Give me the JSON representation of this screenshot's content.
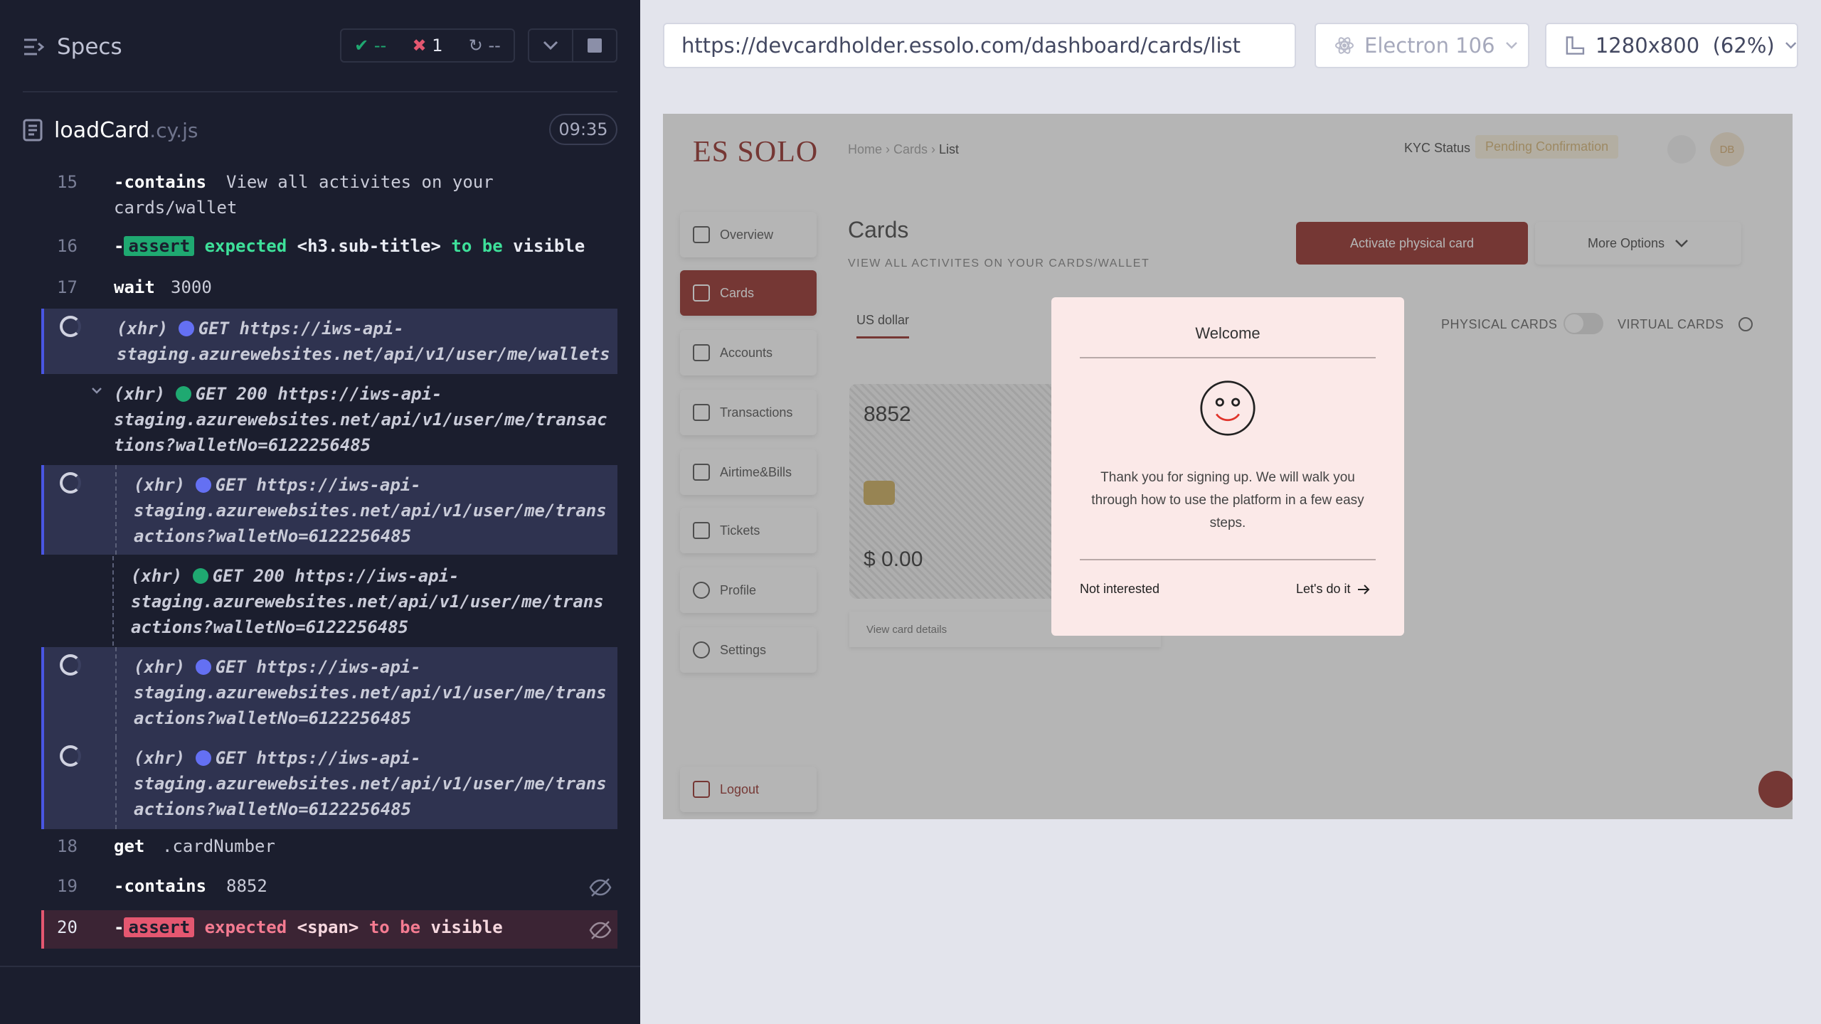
{
  "runner": {
    "title": "Specs",
    "stats": {
      "passed": "--",
      "failed": "1",
      "pending": "--"
    },
    "file": {
      "name": "loadCard",
      "ext": ".cy.js",
      "duration": "09:35"
    }
  },
  "log": {
    "l15": {
      "num": "15",
      "cmd": "-contains",
      "msg_1": "View all activites on your",
      "msg_2": "cards/wallet"
    },
    "l16": {
      "num": "16",
      "tag": "assert",
      "p1": "expected",
      "p2": "<h3.sub-title>",
      "p3": "to be",
      "p4": "visible"
    },
    "l17": {
      "num": "17",
      "cmd": "wait",
      "msg": "3000"
    },
    "x1": {
      "prefix": "(xhr)",
      "verb": "GET",
      "l1": "https://iws-api-",
      "l2": "staging.azurewebsites.net/api/v1/user/me/wallets"
    },
    "x2": {
      "prefix": "(xhr)",
      "verb": "GET 200",
      "l1": "https://iws-api-",
      "l2": "staging.azurewebsites.net/api/v1/user/me/transac",
      "l3": "tions?walletNo=6122256485"
    },
    "x3": {
      "prefix": "(xhr)",
      "verb": "GET",
      "l1": "https://iws-api-",
      "l2": "staging.azurewebsites.net/api/v1/user/me/trans",
      "l3": "actions?walletNo=6122256485"
    },
    "x4": {
      "prefix": "(xhr)",
      "verb": "GET 200",
      "l1": "https://iws-api-",
      "l2": "staging.azurewebsites.net/api/v1/user/me/trans",
      "l3": "actions?walletNo=6122256485"
    },
    "x5": {
      "prefix": "(xhr)",
      "verb": "GET",
      "l1": "https://iws-api-",
      "l2": "staging.azurewebsites.net/api/v1/user/me/trans",
      "l3": "actions?walletNo=6122256485"
    },
    "x6": {
      "prefix": "(xhr)",
      "verb": "GET",
      "l1": "https://iws-api-",
      "l2": "staging.azurewebsites.net/api/v1/user/me/trans",
      "l3": "actions?walletNo=6122256485"
    },
    "l18": {
      "num": "18",
      "cmd": "get",
      "msg": ".cardNumber"
    },
    "l19": {
      "num": "19",
      "cmd": "-contains",
      "msg": "8852"
    },
    "l20": {
      "num": "20",
      "tag": "assert",
      "p1": "expected",
      "p2": "<span>",
      "p3": "to be",
      "p4": "visible"
    }
  },
  "toolbar": {
    "url": "https://devcardholder.essolo.com/dashboard/cards/list",
    "browser": "Electron 106",
    "viewport": "1280x800  (62%)"
  },
  "app": {
    "logo": "ES SOLO",
    "breadcrumb": {
      "home": "Home",
      "cards": "Cards",
      "current": "List"
    },
    "kyc_label": "KYC Status",
    "kyc_status": "Pending Confirmation",
    "avatar": "DB",
    "sidebar": [
      "Overview",
      "Cards",
      "Accounts",
      "Transactions",
      "Airtime&Bills",
      "Tickets",
      "Profile",
      "Settings"
    ],
    "logout": "Logout",
    "page_title": "Cards",
    "page_subtitle": "VIEW ALL ACTIVITES ON YOUR CARDS/WALLET",
    "activate_btn": "Activate physical card",
    "more_btn": "More Options",
    "tab_currency": "US dollar",
    "physical_label": "PHYSICAL CARDS",
    "virtual_label": "VIRTUAL CARDS",
    "card_number": "8852",
    "card_balance": "$ 0.00",
    "card_details": "View card details",
    "modal": {
      "title": "Welcome",
      "body": "Thank you for signing up. We will walk you through how to use the platform in a few easy steps.",
      "decline": "Not interested",
      "accept": "Let's do it"
    },
    "brand_color": "#8b1b14"
  }
}
